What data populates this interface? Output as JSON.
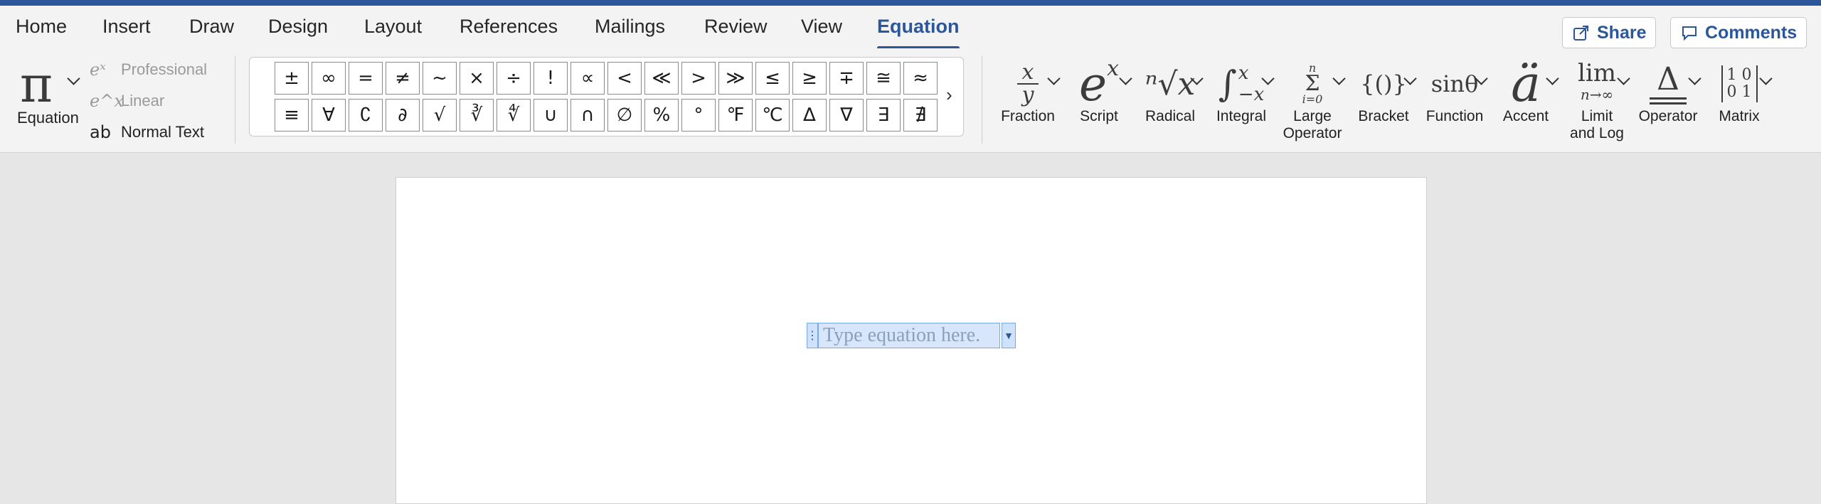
{
  "tabs": [
    "Home",
    "Insert",
    "Draw",
    "Design",
    "Layout",
    "References",
    "Mailings",
    "Review",
    "View",
    "Equation"
  ],
  "active_tab": "Equation",
  "actions": {
    "share": "Share",
    "comments": "Comments"
  },
  "equation_group": {
    "main_label": "Equation",
    "main_icon": "π",
    "conversions": [
      {
        "icon": "eˣ",
        "label": "Professional"
      },
      {
        "icon": "e^x",
        "label": "Linear"
      },
      {
        "icon": "ab",
        "label": "Normal Text"
      }
    ]
  },
  "symbols": {
    "row1": [
      "±",
      "∞",
      "=",
      "≠",
      "~",
      "×",
      "÷",
      "!",
      "∝",
      "<",
      "≪",
      ">",
      "≫",
      "≤",
      "≥",
      "∓",
      "≅",
      "≈"
    ],
    "row2": [
      "≡",
      "∀",
      "∁",
      "∂",
      "√",
      "∛",
      "∜",
      "∪",
      "∩",
      "∅",
      "%",
      "°",
      "℉",
      "℃",
      "∆",
      "∇",
      "∃",
      "∄"
    ],
    "more": "›"
  },
  "structures": [
    {
      "label": "Fraction",
      "icon": "fraction-icon"
    },
    {
      "label": "Script",
      "icon": "script-icon"
    },
    {
      "label": "Radical",
      "icon": "radical-icon"
    },
    {
      "label": "Integral",
      "icon": "integral-icon"
    },
    {
      "label": "Large Operator",
      "icon": "large-operator-icon"
    },
    {
      "label": "Bracket",
      "icon": "bracket-icon"
    },
    {
      "label": "Function",
      "icon": "function-icon"
    },
    {
      "label": "Accent",
      "icon": "accent-icon"
    },
    {
      "label": "Limit and Log",
      "icon": "limit-icon"
    },
    {
      "label": "Operator",
      "icon": "operator-icon"
    },
    {
      "label": "Matrix",
      "icon": "matrix-icon"
    }
  ],
  "icon_text": {
    "fraction_num": "x",
    "fraction_den": "y",
    "script_base": "e",
    "script_sup": "x",
    "radical": "ⁿ√x",
    "integral": "∫",
    "integral_top": "x",
    "integral_bot": "−x",
    "sum_top": "n",
    "sum": "Σ",
    "sum_bot": "i=0",
    "bracket": "{()}",
    "function": "sinθ",
    "accent": "ä",
    "lim": "lim",
    "lim_sub": "n→∞",
    "operator": "Δ",
    "matrix_r1": "1 0",
    "matrix_r2": "0 1"
  },
  "document": {
    "equation_placeholder": "Type equation here."
  },
  "colors": {
    "accent": "#2b579a",
    "equation_bg": "#d7e6fb"
  }
}
